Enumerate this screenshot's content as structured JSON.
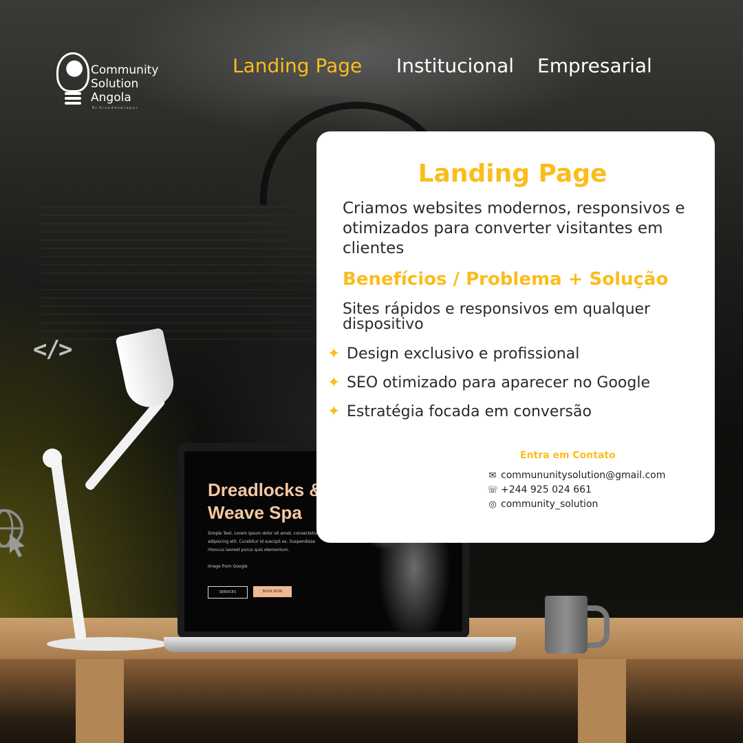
{
  "brand": {
    "line1": "Community",
    "line2": "Solution",
    "line3": "Angola",
    "tagline": "B.I.  A.l.s.o  d.e.v.e.l.o.p.e.r"
  },
  "nav": {
    "items": [
      {
        "label": "Landing Page",
        "active": true
      },
      {
        "label": "Institucional",
        "active": false
      },
      {
        "label": "Empresarial",
        "active": false
      }
    ]
  },
  "decor": {
    "code_icon": "</>"
  },
  "card": {
    "title": "Landing Page",
    "intro": "Criamos websites modernos, responsivos e otimizados para converter visitantes em clientes",
    "subtitle": "Benefícios / Problema + Solução",
    "lead": "Sites rápidos e responsivos em qualquer dispositivo",
    "benefits": [
      "Design exclusivo e profissional",
      "SEO otimizado para aparecer no Google",
      "Estratégia focada em conversão"
    ],
    "contact": {
      "heading": "Entra em Contato",
      "email": "commununitysolution@gmail.com",
      "phone": "+244 925 024 661",
      "instagram": "community_solution"
    }
  },
  "laptop": {
    "title_line1": "Dreadlocks &",
    "title_line2": "Weave Spa",
    "body": "Simple Text. Lorem ipsum dolor sit amet, consectetur adipiscing elit. Curabitur id suscipit ex. Suspendisse rhoncus laoreet purus quis elementum.",
    "credit": "Image from Google",
    "btn_services": "SERVICES",
    "btn_book": "BOOK NOW"
  },
  "colors": {
    "accent": "#fbbd1c",
    "card_bg": "#ffffff",
    "text_dark": "#2a2a2a"
  },
  "icons": {
    "benefit": "sparkle-icon",
    "email": "email-icon",
    "phone": "phone-icon",
    "instagram": "instagram-icon"
  }
}
